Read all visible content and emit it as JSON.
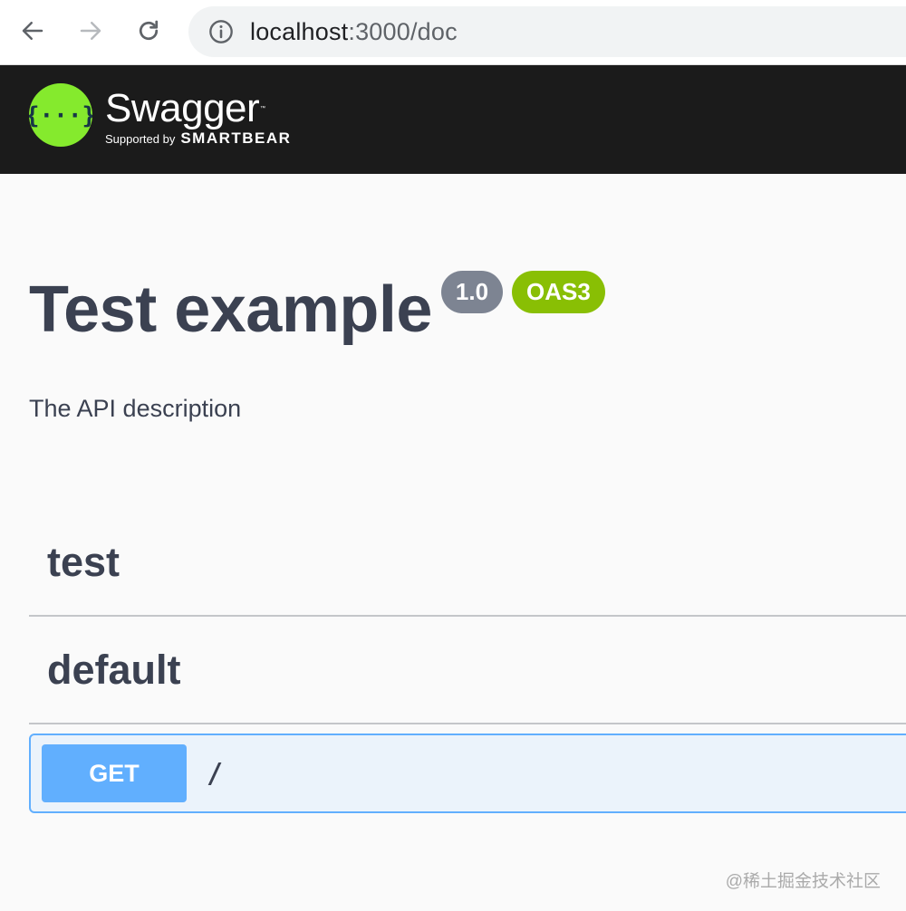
{
  "browser": {
    "url_host": "localhost",
    "url_rest": ":3000/doc"
  },
  "topbar": {
    "logo_name": "Swagger",
    "logo_tm": "™",
    "logo_supported_by": "Supported by",
    "logo_brand": "SMARTBEAR",
    "logo_glyph": "{···}",
    "brand_color": "#85ea2d",
    "background": "#1b1b1b"
  },
  "info": {
    "title": "Test example",
    "version": "1.0",
    "oas_badge": "OAS3",
    "description": "The API description"
  },
  "tags": [
    {
      "name": "test"
    },
    {
      "name": "default"
    }
  ],
  "operations": [
    {
      "method": "GET",
      "path": "/",
      "method_color": "#61affe"
    }
  ],
  "watermark": "@稀土掘金技术社区",
  "icons": {
    "back": "arrow-left-icon",
    "forward": "arrow-right-icon",
    "reload": "reload-icon",
    "info": "info-icon"
  }
}
